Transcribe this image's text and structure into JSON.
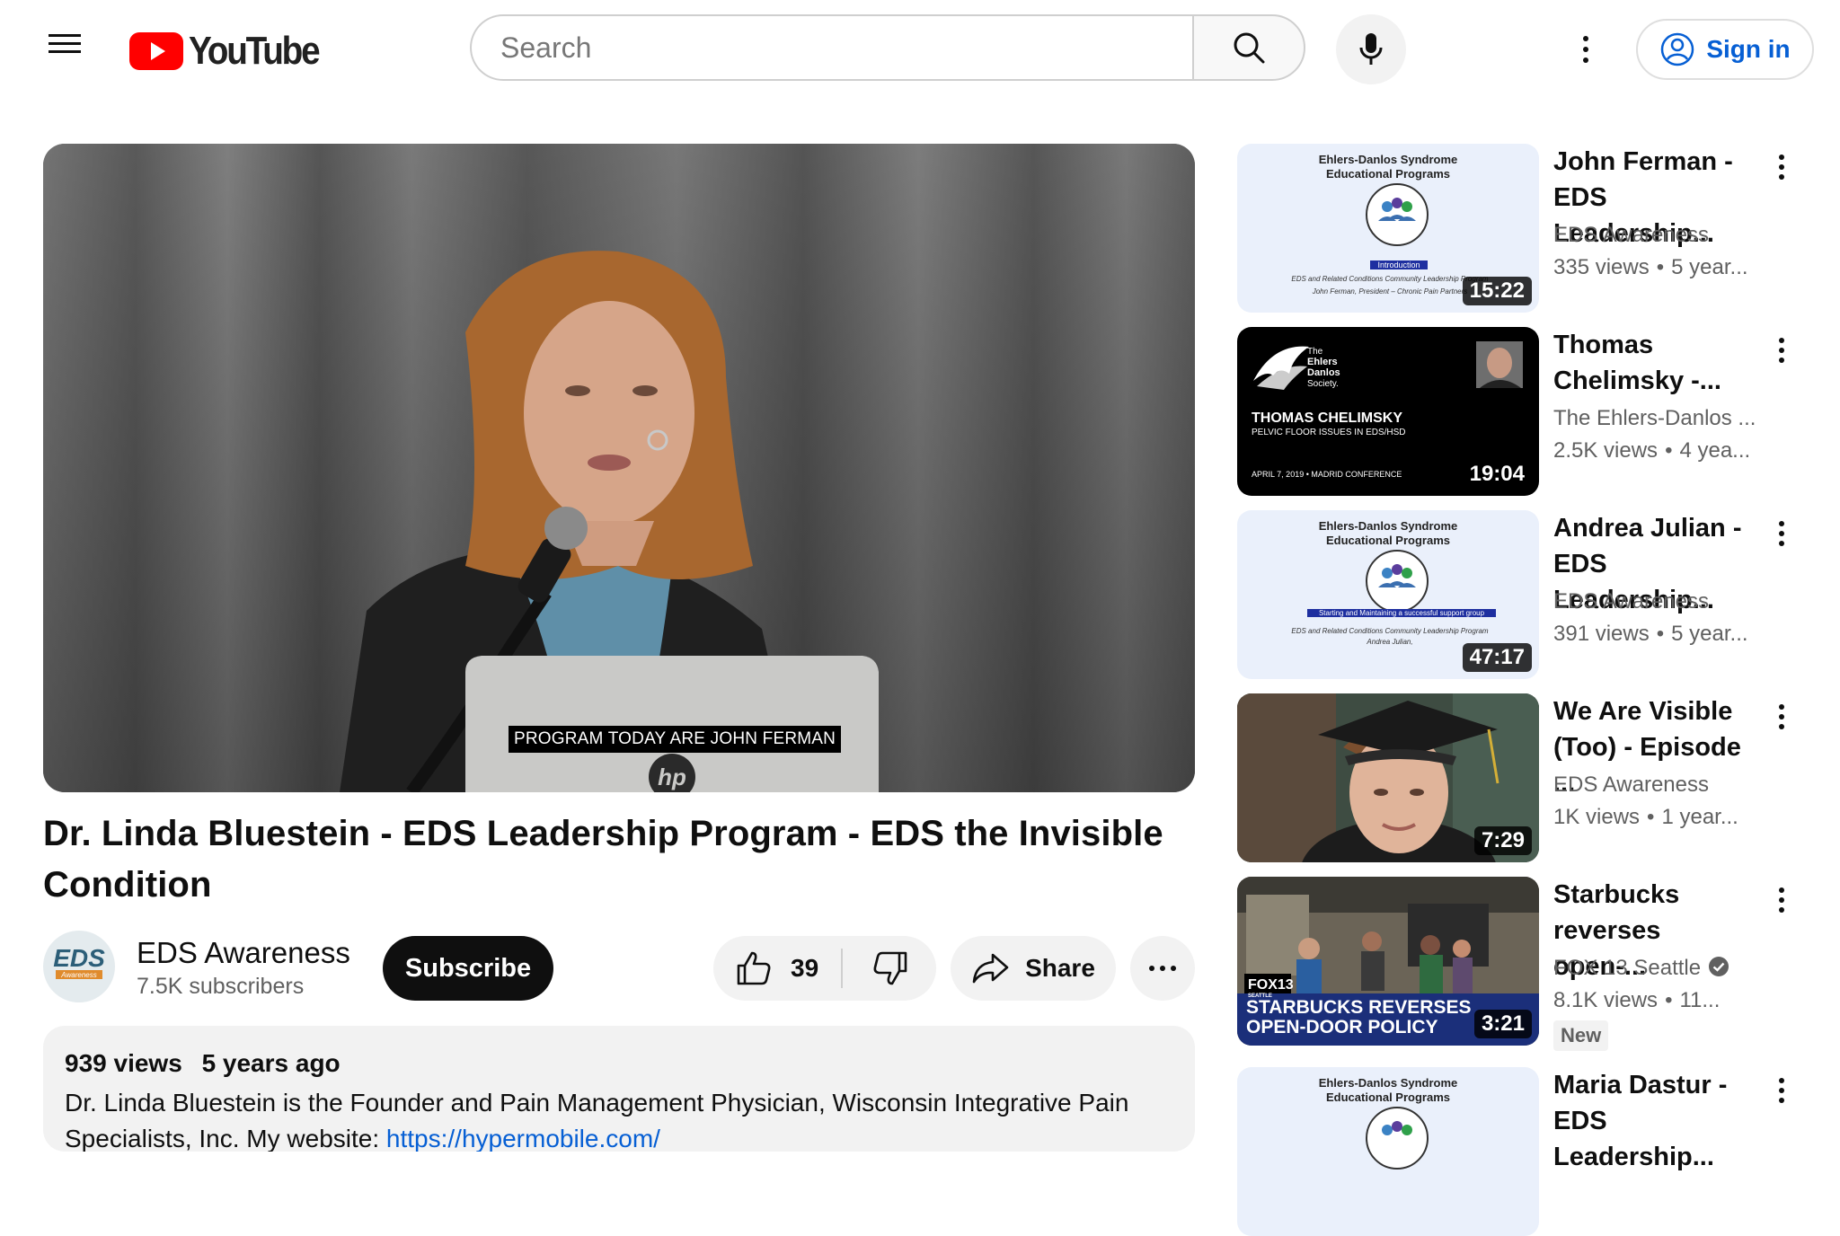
{
  "header": {
    "logo_text": "YouTube",
    "search_placeholder": "Search",
    "sign_in_label": "Sign in"
  },
  "player": {
    "caption": "PROGRAM TODAY ARE JOHN FERMAN"
  },
  "video": {
    "title": "Dr. Linda Bluestein - EDS Leadership Program - EDS the Invisible Condition",
    "channel_name": "EDS Awareness",
    "subscribers": "7.5K subscribers",
    "subscribe_label": "Subscribe",
    "likes": "39",
    "share_label": "Share",
    "avatar_text": "EDS",
    "avatar_subtext": "Awareness"
  },
  "description": {
    "views": "939 views",
    "age": "5 years ago",
    "text": "Dr. Linda Bluestein is the Founder and Pain Management Physician, Wisconsin Integrative Pain Specialists, Inc. My website: ",
    "link": "https://hypermobile.com/"
  },
  "recommendations": [
    {
      "title": "John Ferman - EDS Leadership...",
      "channel": "EDS Awareness",
      "views": "335 views",
      "age": "5 year...",
      "duration": "15:22",
      "thumb_heading_1": "Ehlers-Danlos Syndrome",
      "thumb_heading_2": "Educational Programs",
      "thumb_subtitle": "Introduction",
      "thumb_line": "EDS and Related Conditions Community Leadership Program",
      "thumb_line_2": "John Ferman, President – Chronic Pain Partners"
    },
    {
      "title": "Thomas Chelimsky -...",
      "channel": "The Ehlers-Danlos ...",
      "views": "2.5K views",
      "age": "4 yea...",
      "duration": "19:04",
      "thumb_logo_1": "The",
      "thumb_logo_2": "Ehlers",
      "thumb_logo_3": "Danlos",
      "thumb_logo_4": "Society.",
      "thumb_name": "THOMAS CHELIMSKY",
      "thumb_topic": "PELVIC FLOOR ISSUES IN EDS/HSD",
      "thumb_date": "APRIL 7, 2019 • MADRID CONFERENCE"
    },
    {
      "title": "Andrea Julian - EDS Leadership...",
      "channel": "EDS Awareness",
      "views": "391 views",
      "age": "5 year...",
      "duration": "47:17",
      "thumb_heading_1": "Ehlers-Danlos Syndrome",
      "thumb_heading_2": "Educational Programs",
      "thumb_subtitle": "Starting and Maintaining a successful support group",
      "thumb_line": "EDS and Related Conditions Community Leadership Program",
      "thumb_line_2": "Andrea Julian,"
    },
    {
      "title": "We Are Visible (Too) - Episode ...",
      "channel": "EDS Awareness",
      "views": "1K views",
      "age": "1 year...",
      "duration": "7:29"
    },
    {
      "title": "Starbucks reverses open-...",
      "channel": "FOX 13 Seattle",
      "views": "8.1K views",
      "age": "11...",
      "duration": "3:21",
      "badge": "New",
      "thumb_brand": "FOX13",
      "thumb_brand_sub": "SEATTLE",
      "thumb_headline_1": "STARBUCKS REVERSES",
      "thumb_headline_2": "OPEN-DOOR POLICY"
    },
    {
      "title": "Maria Dastur - EDS Leadership...",
      "thumb_heading_1": "Ehlers-Danlos Syndrome",
      "thumb_heading_2": "Educational Programs"
    }
  ],
  "colors": {
    "brand_red": "#ff0000",
    "link_blue": "#065fd4",
    "chip_bg": "#f2f2f2"
  },
  "icons": [
    "menu-icon",
    "search-icon",
    "mic-icon",
    "more-vert-icon",
    "account-icon",
    "thumb-up-icon",
    "thumb-down-icon",
    "share-icon",
    "more-horiz-icon",
    "verified-icon"
  ]
}
